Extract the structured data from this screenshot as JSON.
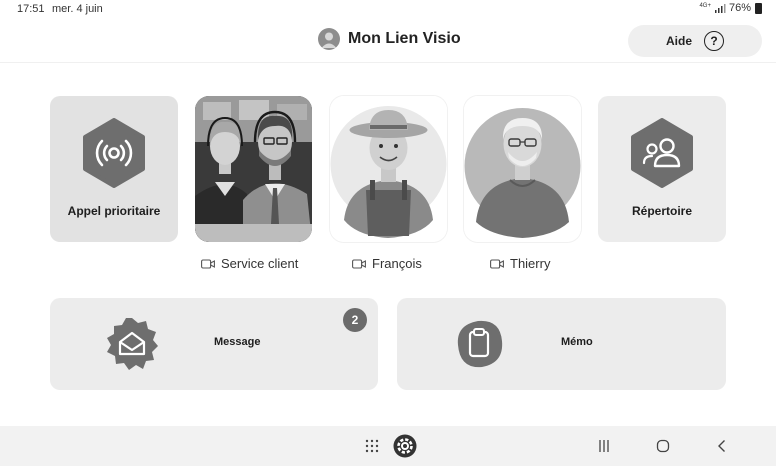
{
  "status_bar": {
    "time": "17:51",
    "date": "mer. 4 juin",
    "network": "4G+",
    "battery": "76%"
  },
  "header": {
    "title": "Mon Lien Visio",
    "help_label": "Aide",
    "help_icon": "?"
  },
  "tiles": {
    "priority_call": "Appel prioritaire",
    "directory": "Répertoire",
    "message": "Message",
    "message_badge": "2",
    "memo": "Mémo"
  },
  "contacts": [
    {
      "name": "Service client",
      "icon": "video-icon"
    },
    {
      "name": "François",
      "icon": "video-icon"
    },
    {
      "name": "Thierry",
      "icon": "video-icon"
    }
  ],
  "nav": {
    "icons": [
      "apps-grid-icon",
      "settings-gear-icon",
      "recents-icon",
      "home-icon",
      "back-icon"
    ]
  },
  "colors": {
    "tile_bg": "#ececec",
    "icon_dark": "#6e6e6e",
    "badge": "#6b6b6b"
  }
}
